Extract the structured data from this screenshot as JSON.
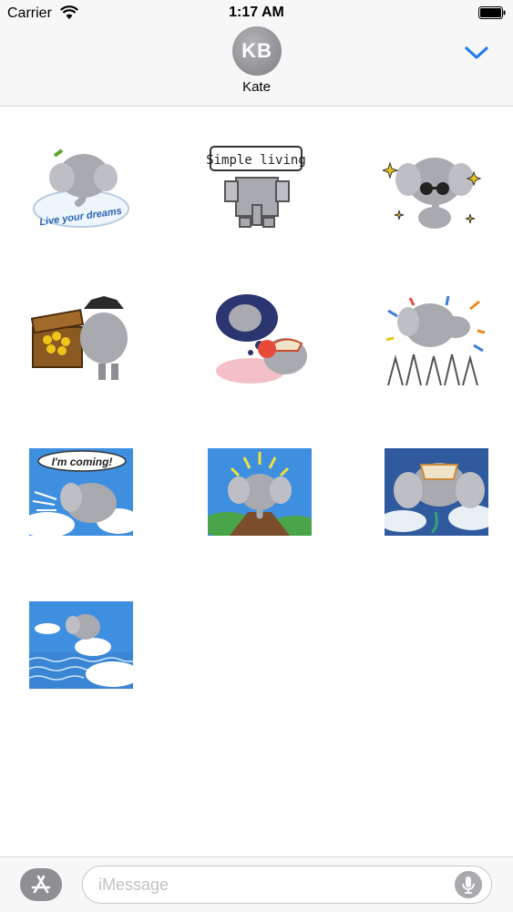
{
  "status_bar": {
    "carrier": "Carrier",
    "time": "1:17 AM"
  },
  "header": {
    "avatar_initials": "KB",
    "contact_name": "Kate",
    "collapse_icon": "chevron-down-icon"
  },
  "stickers": [
    {
      "id": "dream-cloud",
      "caption": "Live your dreams"
    },
    {
      "id": "pixel-elephant",
      "caption": "Simple living"
    },
    {
      "id": "sunglasses-elephant",
      "caption": ""
    },
    {
      "id": "pirate-treasure",
      "caption": ""
    },
    {
      "id": "dreaming-elephant",
      "caption": ""
    },
    {
      "id": "crowd-surf",
      "caption": ""
    },
    {
      "id": "flying-elephant",
      "caption": "I'm coming!"
    },
    {
      "id": "mountain-elephant",
      "caption": ""
    },
    {
      "id": "parachute-elephant",
      "caption": ""
    },
    {
      "id": "sea-elephant",
      "caption": ""
    }
  ],
  "input": {
    "placeholder": "iMessage"
  },
  "colors": {
    "accent": "#1e7cf2",
    "elephant": "#a8aab0",
    "sky": "#3f8fe0"
  }
}
